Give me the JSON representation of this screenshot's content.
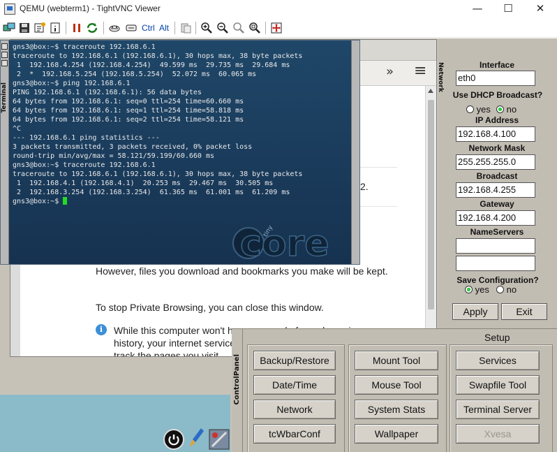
{
  "window": {
    "title": "QEMU (webterm1) - TightVNC Viewer"
  },
  "toolbar": {
    "ctrl_label": "Ctrl",
    "alt_label": "Alt"
  },
  "terminal": {
    "side_label": "Terminal",
    "lines": [
      "gns3@box:~$ traceroute 192.168.6.1",
      "traceroute to 192.168.6.1 (192.168.6.1), 30 hops max, 38 byte packets",
      " 1  192.168.4.254 (192.168.4.254)  49.599 ms  29.735 ms  29.684 ms",
      " 2  *  192.168.5.254 (192.168.5.254)  52.072 ms  60.065 ms",
      "gns3@box:~$ ping 192.168.6.1",
      "PING 192.168.6.1 (192.168.6.1): 56 data bytes",
      "64 bytes from 192.168.6.1: seq=0 ttl=254 time=60.660 ms",
      "64 bytes from 192.168.6.1: seq=1 ttl=254 time=58.818 ms",
      "64 bytes from 192.168.6.1: seq=2 ttl=254 time=58.121 ms",
      "^C",
      "--- 192.168.6.1 ping statistics ---",
      "3 packets transmitted, 3 packets received, 0% packet loss",
      "round-trip min/avg/max = 58.121/59.199/60.660 ms",
      "gns3@box:~$ traceroute 192.168.6.1",
      "traceroute to 192.168.6.1 (192.168.6.1), 30 hops max, 38 byte packets",
      " 1  192.168.4.1 (192.168.4.1)  20.253 ms  29.467 ms  30.505 ms",
      " 2  192.168.3.254 (192.168.3.254)  61.365 ms  61.001 ms  61.209 ms",
      "gns3@box:~$ "
    ],
    "logo_text": "core",
    "logo_small": "tiny"
  },
  "browser": {
    "overflow_label": "»",
    "menu_label": "≡",
    "partial_char": "2.",
    "para1": "However, files you download and bookmarks you make will be kept.",
    "para2": "To stop Private Browsing, you can close this window.",
    "para3": "While this computer won't have a record of your browsing history, your internet service provider or employer can still track the pages you visit."
  },
  "network": {
    "panel_title": "Network",
    "interface_label": "Interface",
    "interface_value": "eth0",
    "dhcp_label": "Use DHCP Broadcast?",
    "dhcp_yes": "yes",
    "dhcp_no": "no",
    "ip_label": "IP Address",
    "ip_value": "192.168.4.100",
    "mask_label": "Network Mask",
    "mask_value": "255.255.255.0",
    "broadcast_label": "Broadcast",
    "broadcast_value": "192.168.4.255",
    "gateway_label": "Gateway",
    "gateway_value": "192.168.4.200",
    "ns_label": "NameServers",
    "ns1_value": "",
    "ns2_value": "",
    "save_label": "Save Configuration?",
    "save_yes": "yes",
    "save_no": "no",
    "apply_label": "Apply",
    "exit_label": "Exit"
  },
  "control_panel": {
    "side_label": "ControlPanel",
    "setup_title": "Setup",
    "col1": [
      "Backup/Restore",
      "Date/Time",
      "Network",
      "tcWbarConf"
    ],
    "col2": [
      "Mount Tool",
      "Mouse Tool",
      "System Stats",
      "Wallpaper"
    ],
    "col3": [
      "Services",
      "Swapfile Tool",
      "Terminal Server",
      "Xvesa"
    ]
  },
  "colors": {
    "terminal_bg": "#1a3a5a",
    "cursor": "#22dd22",
    "panel_bg": "#c2bdb3",
    "toolbar_text": "#003fa8"
  }
}
